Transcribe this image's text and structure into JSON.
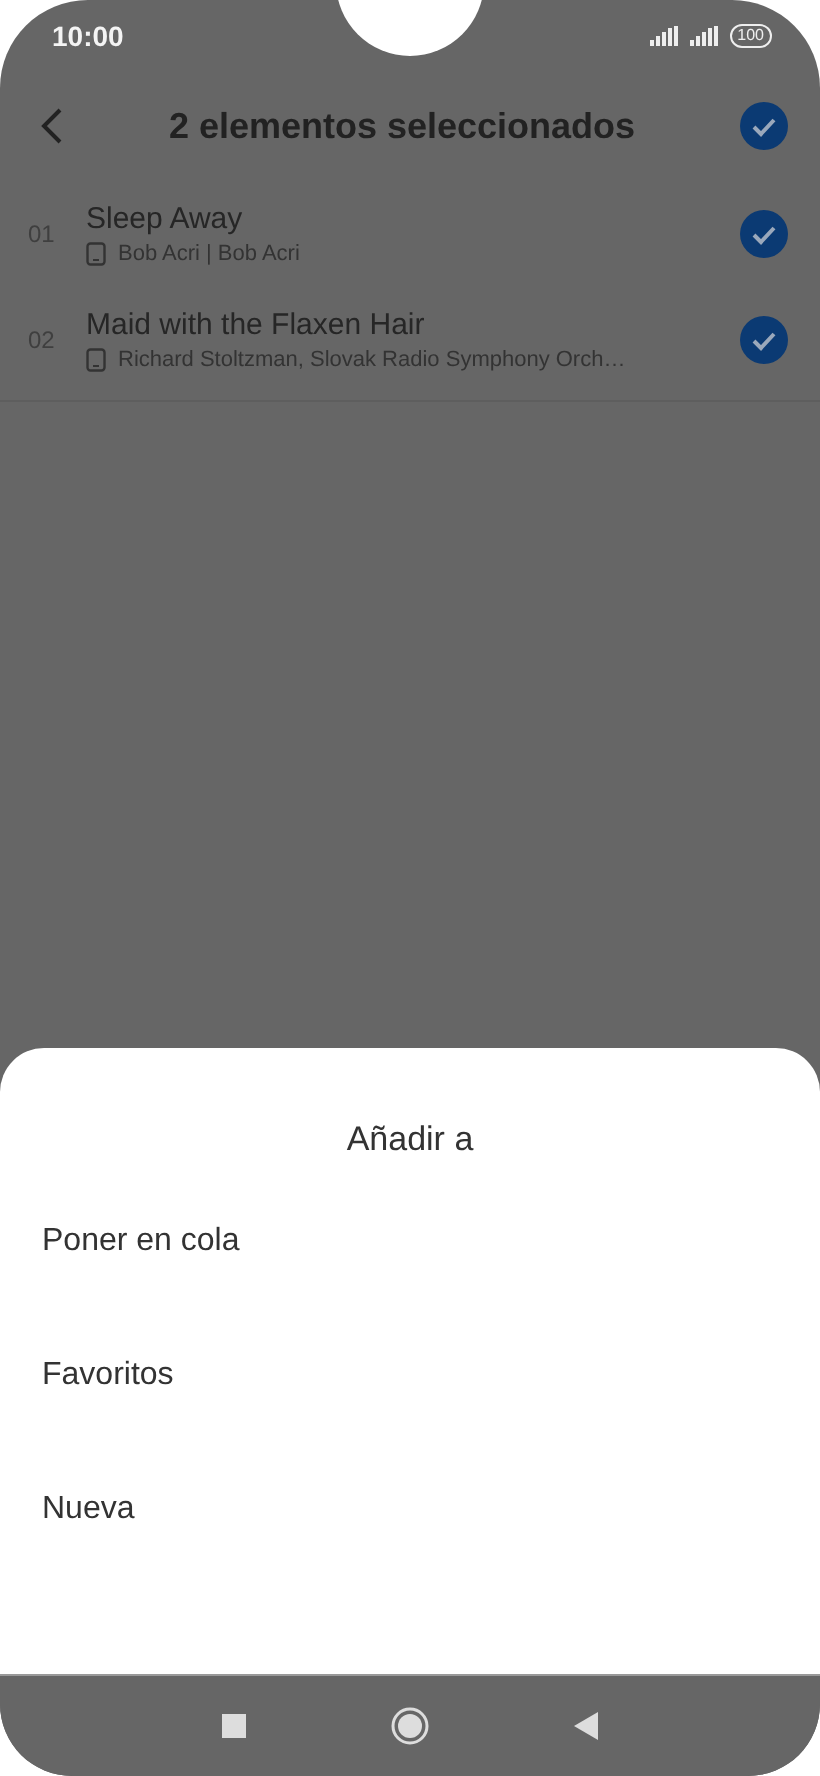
{
  "status_bar": {
    "time": "10:00",
    "battery": "100"
  },
  "header": {
    "title": "2 elementos seleccionados",
    "all_selected": true
  },
  "tracks": [
    {
      "number": "01",
      "title": "Sleep Away",
      "artist": "Bob Acri | Bob Acri",
      "selected": true
    },
    {
      "number": "02",
      "title": "Maid with the Flaxen Hair",
      "artist": "Richard Stoltzman, Slovak Radio Symphony Orch…",
      "selected": true
    }
  ],
  "sheet": {
    "title": "Añadir a",
    "options": [
      "Poner en cola",
      "Favoritos",
      "Nueva"
    ]
  }
}
